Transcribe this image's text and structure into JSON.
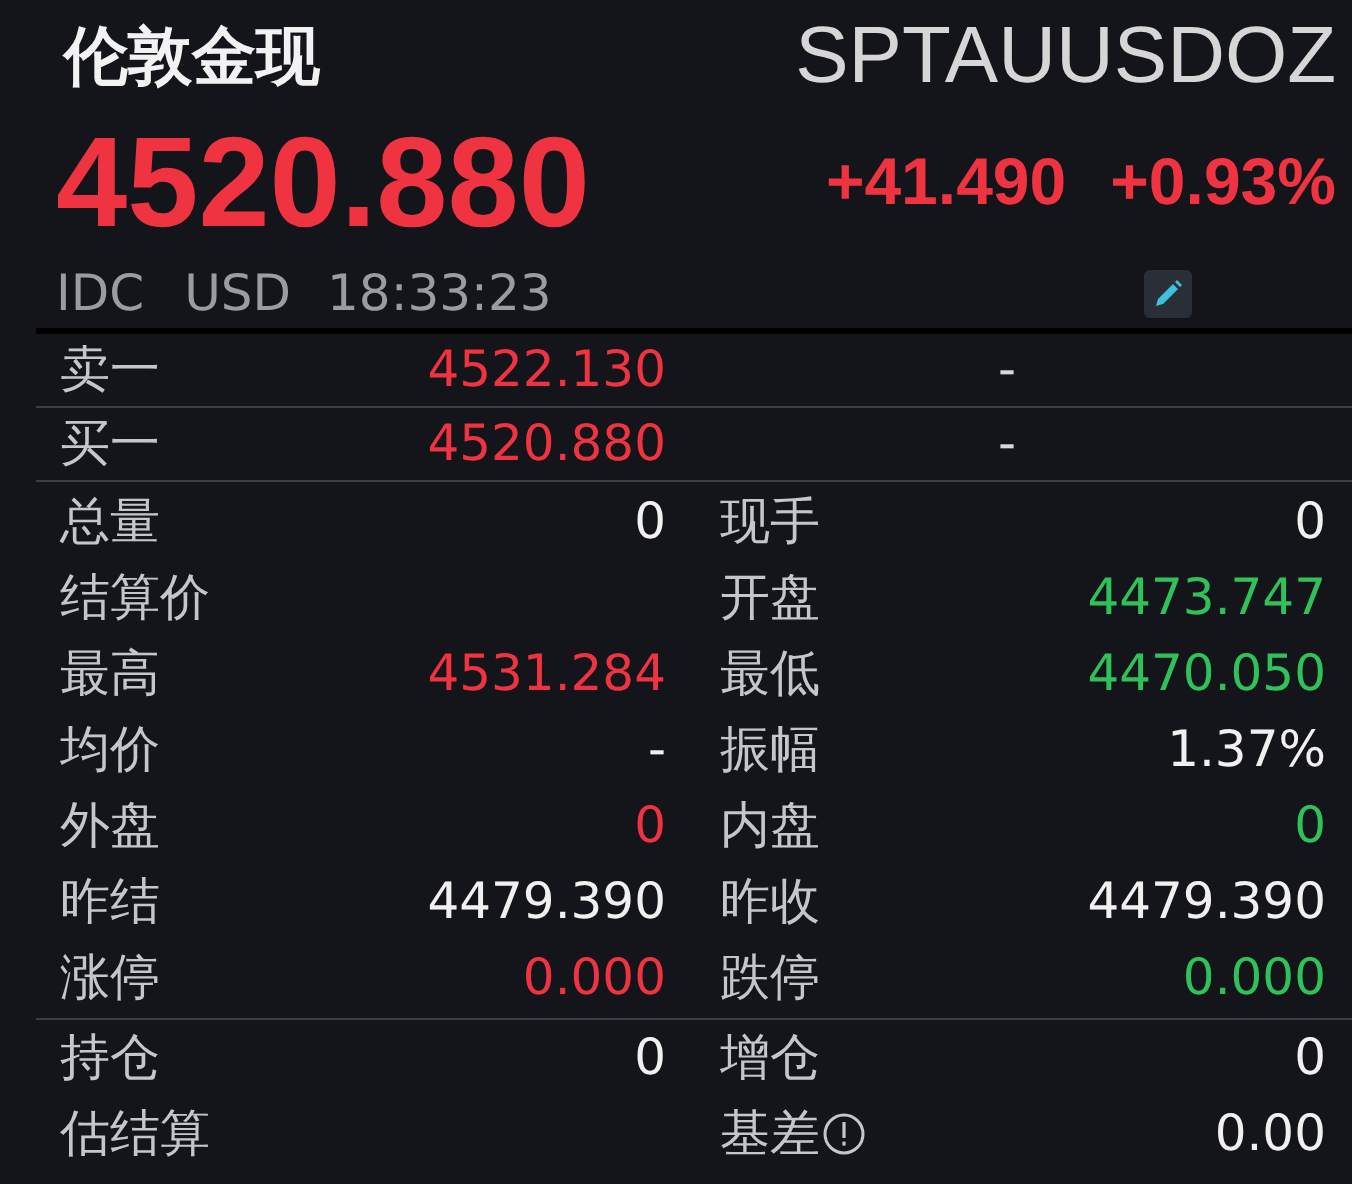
{
  "header": {
    "name": "伦敦金现",
    "symbol": "SPTAUUSDOZ",
    "price": "4520.880",
    "change": "+41.490",
    "change_pct": "+0.93%",
    "source": "IDC",
    "currency": "USD",
    "time": "18:33:23"
  },
  "order_book": [
    {
      "label": "卖一",
      "price": "4522.130",
      "color": "#ef3340",
      "volume": "-"
    },
    {
      "label": "买一",
      "price": "4520.880",
      "color": "#ef3340",
      "volume": "-"
    }
  ],
  "stats": [
    {
      "label": "总量",
      "value": "0",
      "color": "#f0f0f0"
    },
    {
      "label": "现手",
      "value": "0",
      "color": "#f0f0f0"
    },
    {
      "label": "结算价"
    },
    {
      "label": "开盘",
      "value": "4473.747",
      "color": "#30c25a"
    },
    {
      "label": "最高",
      "value": "4531.284",
      "color": "#ef3340"
    },
    {
      "label": "最低",
      "value": "4470.050",
      "color": "#30c25a"
    },
    {
      "label": "均价",
      "value": "-",
      "color": "#f0f0f0"
    },
    {
      "label": "振幅",
      "value": "1.37%",
      "color": "#f0f0f0"
    },
    {
      "label": "外盘",
      "value": "0",
      "color": "#ef3340"
    },
    {
      "label": "内盘",
      "value": "0",
      "color": "#30c25a"
    },
    {
      "label": "昨结",
      "value": "4479.390",
      "color": "#f0f0f0"
    },
    {
      "label": "昨收",
      "value": "4479.390",
      "color": "#f0f0f0"
    },
    {
      "label": "涨停",
      "value": "0.000",
      "color": "#ef3340"
    },
    {
      "label": "跌停",
      "value": "0.000",
      "color": "#30c25a"
    }
  ],
  "positions": [
    {
      "label": "持仓",
      "value": "0",
      "color": "#f0f0f0",
      "info": false
    },
    {
      "label": "增仓",
      "value": "0",
      "color": "#f0f0f0",
      "info": false
    },
    {
      "label": "估结算",
      "info": false
    },
    {
      "label": "基差",
      "value": "0.00",
      "color": "#f0f0f0",
      "info": true
    }
  ]
}
